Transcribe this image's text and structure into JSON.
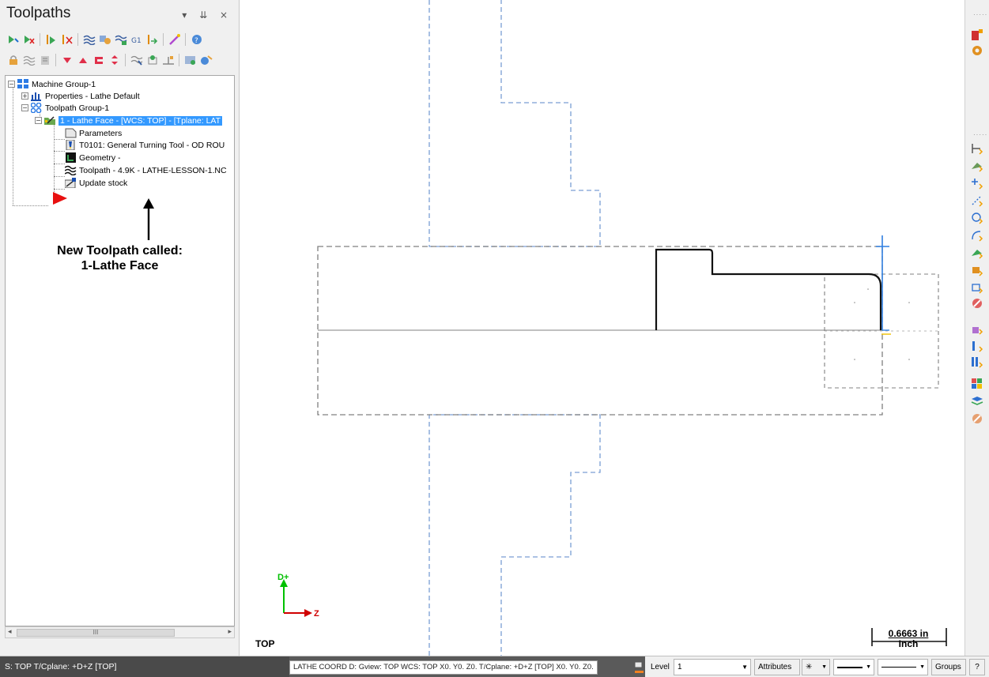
{
  "panel": {
    "title": "Toolpaths",
    "controls": "▾ ⇊ ×"
  },
  "toolbar_row1": [
    "select-all-icon",
    "deselect-icon",
    "select-dirty-icon",
    "delete-dirty-icon",
    "regenerate-all-icon",
    "regenerate-dirty-icon",
    "backplot-icon",
    "verify-icon",
    "simulate-icon",
    "post-icon",
    "help-icon"
  ],
  "toolbar_row2": [
    "lock-icon",
    "toggle-display-icon",
    "toggle-posting-icon",
    "move-down-icon",
    "move-up-icon",
    "insert-arrow-icon",
    "scroll-icon",
    "only-display-icon",
    "display-icon",
    "stock-icon",
    "tool-manager-icon",
    "compare-icon"
  ],
  "tree": {
    "machine_group": "Machine Group-1",
    "properties": "Properties - Lathe Default",
    "toolpath_group": "Toolpath Group-1",
    "operation": "1 - Lathe Face - [WCS: TOP] - [Tplane: LAT",
    "parameters": "Parameters",
    "tool": "T0101: General Turning Tool - OD ROU",
    "geometry": "Geometry -",
    "toolpath": "Toolpath - 4.9K - LATHE-LESSON-1.NC",
    "update_stock": "Update stock"
  },
  "annotation": {
    "line1": "New Toolpath called:",
    "line2": "1-Lathe Face"
  },
  "scrollbar": {
    "thumb_label": "III"
  },
  "viewport": {
    "view_name": "TOP",
    "axis_d": "D+",
    "axis_z": "Z",
    "scale_value": "0.6663 in",
    "scale_unit": "Inch"
  },
  "statusbar": {
    "left": "S: TOP  T/Cplane: +D+Z [TOP]",
    "coord": "LATHE COORD D: Gview: TOP  WCS: TOP X0. Y0. Z0.  T/Cplane: +D+Z [TOP] X0. Y0. Z0.",
    "level_label": "Level",
    "level_value": "1",
    "attributes": "Attributes",
    "point_style": "✳",
    "groups": "Groups",
    "help": "?"
  },
  "colors": {
    "selection": "#3399ff",
    "stock_dash": "#808080",
    "chuck_dash": "#7a9ed4",
    "part_profile": "#111111",
    "tool_line": "#2f7fe0",
    "axis_green": "#00c000",
    "axis_red": "#d00000",
    "status_dark": "#4a4a4a"
  }
}
